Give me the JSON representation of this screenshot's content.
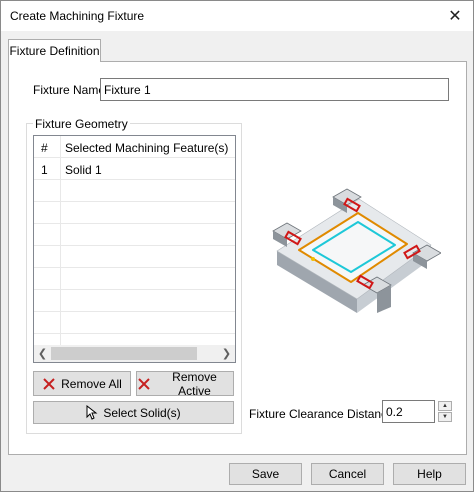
{
  "window": {
    "title": "Create Machining Fixture",
    "close_glyph": "✕"
  },
  "tab": {
    "label": "Fixture Definition"
  },
  "fixture_name": {
    "label": "Fixture Name:",
    "value": "Fixture 1"
  },
  "geometry": {
    "group_title": "Fixture Geometry",
    "columns": [
      "#",
      "Selected Machining Feature(s)"
    ],
    "rows": [
      {
        "num": "1",
        "feature": "Solid 1"
      }
    ],
    "remove_all_label": "Remove All",
    "remove_active_label": "Remove Active",
    "select_solids_label": "Select Solid(s)"
  },
  "clearance": {
    "label": "Fixture Clearance Distance",
    "value": "0.2"
  },
  "footer": {
    "save_label": "Save",
    "cancel_label": "Cancel",
    "help_label": "Help"
  },
  "colors": {
    "accent_red": "#d01818",
    "slot_orange": "#e08a00",
    "contour_cyan": "#1ec8d8"
  }
}
